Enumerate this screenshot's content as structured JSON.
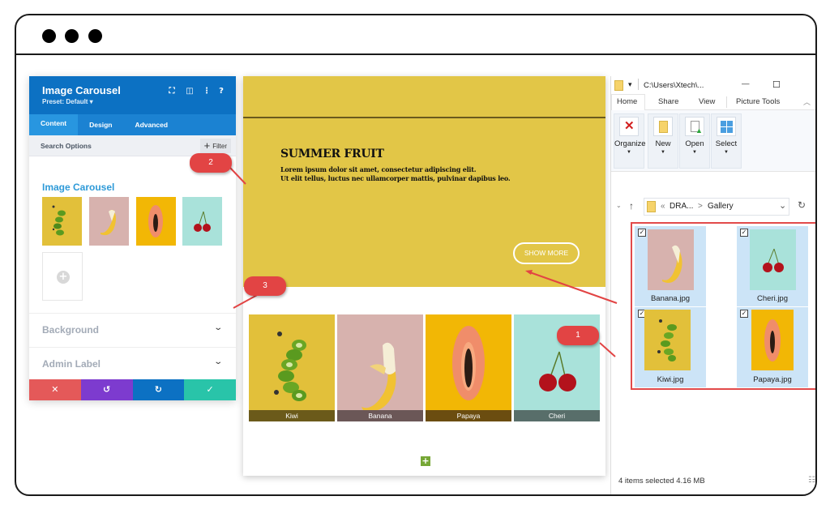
{
  "window": {
    "traffic_dots": 3
  },
  "divi_panel": {
    "title": "Image Carousel",
    "preset": "Preset: Default ▾",
    "header_icons": [
      "expand-icon",
      "sidebar-icon",
      "more-icon",
      "help-icon"
    ],
    "header_icon_glyphs": [
      "⛶",
      "◫",
      "⋮",
      "?"
    ],
    "tabs": [
      {
        "label": "Content",
        "active": true
      },
      {
        "label": "Design",
        "active": false
      },
      {
        "label": "Advanced",
        "active": false
      }
    ],
    "search_label": "Search Options",
    "filter_label": "Filter",
    "section_title": "Image Carousel",
    "images": [
      "Kiwi",
      "Banana",
      "Papaya",
      "Cheri"
    ],
    "accordions": [
      {
        "label": "Background"
      },
      {
        "label": "Admin Label"
      }
    ],
    "actions": [
      {
        "name": "discard",
        "glyph": "✕",
        "color": "#e45959"
      },
      {
        "name": "undo",
        "glyph": "↺",
        "color": "#7d3bcf"
      },
      {
        "name": "redo",
        "glyph": "↻",
        "color": "#0c71c3"
      },
      {
        "name": "save",
        "glyph": "✓",
        "color": "#29c4a9"
      }
    ]
  },
  "preview": {
    "hero_title": "SUMMER FRUIT",
    "hero_text_1": "Lorem ipsum dolor sit amet, consectetur adipiscing elit.",
    "hero_text_2": "Ut elit tellus, luctus nec ullamcorper mattis, pulvinar dapibus leo.",
    "button_label": "SHOW MORE",
    "hero_color": "#e2c647",
    "carousel": [
      {
        "caption": "Kiwi"
      },
      {
        "caption": "Banana"
      },
      {
        "caption": "Papaya"
      },
      {
        "caption": "Cheri"
      }
    ],
    "add_module": "+"
  },
  "explorer": {
    "path": "C:\\Users\\Xtech\\...",
    "minimize": "—",
    "maximize": "☐",
    "tabs": [
      "Home",
      "Share",
      "View",
      "Picture Tools"
    ],
    "ribbon": [
      {
        "label": "Organize"
      },
      {
        "label": "New"
      },
      {
        "label": "Open"
      },
      {
        "label": "Select"
      }
    ],
    "address": {
      "prefix": "«",
      "segment_1": "DRA...",
      "separator": ">",
      "segment_2": "Gallery"
    },
    "files": [
      {
        "name": "Banana.jpg",
        "checked": true
      },
      {
        "name": "Cheri.jpg",
        "checked": true
      },
      {
        "name": "Kiwi.jpg",
        "checked": true
      },
      {
        "name": "Papaya.jpg",
        "checked": true
      }
    ],
    "status": "4 items selected  4.16 MB"
  },
  "callouts": [
    "1",
    "2",
    "3"
  ]
}
